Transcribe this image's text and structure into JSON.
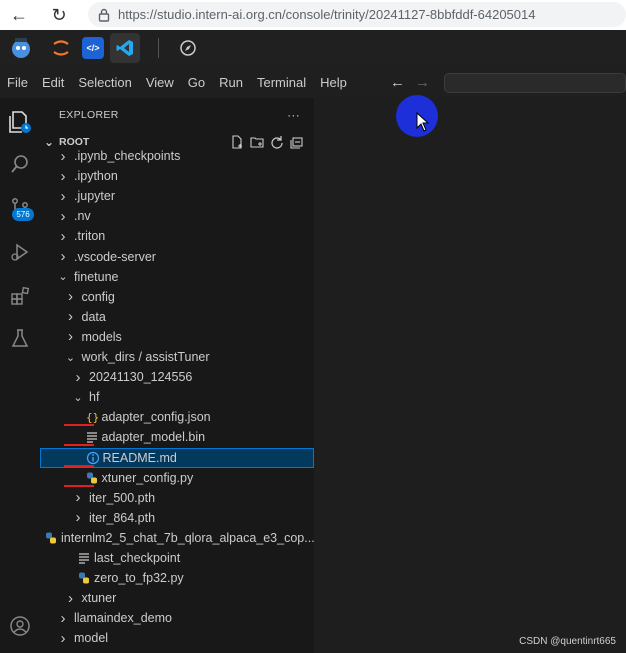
{
  "browser": {
    "url": "https://studio.intern-ai.org.cn/console/trinity/20241127-8bbfddf-64205014"
  },
  "menu": [
    "File",
    "Edit",
    "Selection",
    "View",
    "Go",
    "Run",
    "Terminal",
    "Help"
  ],
  "activity": {
    "scm_badge": "576"
  },
  "explorer": {
    "title": "EXPLORER",
    "more": "···",
    "root": "ROOT",
    "items": [
      {
        "label": ".ipynb_checkpoints",
        "depth": 1,
        "kind": "folder"
      },
      {
        "label": ".ipython",
        "depth": 1,
        "kind": "folder"
      },
      {
        "label": ".jupyter",
        "depth": 1,
        "kind": "folder"
      },
      {
        "label": ".nv",
        "depth": 1,
        "kind": "folder"
      },
      {
        "label": ".triton",
        "depth": 1,
        "kind": "folder"
      },
      {
        "label": ".vscode-server",
        "depth": 1,
        "kind": "folder"
      },
      {
        "label": "finetune",
        "depth": 1,
        "kind": "folder-open"
      },
      {
        "label": "config",
        "depth": 2,
        "kind": "folder"
      },
      {
        "label": "data",
        "depth": 2,
        "kind": "folder"
      },
      {
        "label": "models",
        "depth": 2,
        "kind": "folder"
      },
      {
        "label": "work_dirs / assistTuner",
        "depth": 2,
        "kind": "folder-open"
      },
      {
        "label": "20241130_124556",
        "depth": 3,
        "kind": "folder"
      },
      {
        "label": "hf",
        "depth": 3,
        "kind": "folder-open"
      },
      {
        "label": "adapter_config.json",
        "depth": 4,
        "kind": "json"
      },
      {
        "label": "adapter_model.bin",
        "depth": 4,
        "kind": "bin"
      },
      {
        "label": "README.md",
        "depth": 4,
        "kind": "info"
      },
      {
        "label": "xtuner_config.py",
        "depth": 4,
        "kind": "py"
      },
      {
        "label": "iter_500.pth",
        "depth": 3,
        "kind": "folder"
      },
      {
        "label": "iter_864.pth",
        "depth": 3,
        "kind": "folder"
      },
      {
        "label": "internlm2_5_chat_7b_qlora_alpaca_e3_cop...",
        "depth": 3,
        "kind": "py"
      },
      {
        "label": "last_checkpoint",
        "depth": 3,
        "kind": "bin"
      },
      {
        "label": "zero_to_fp32.py",
        "depth": 3,
        "kind": "py"
      },
      {
        "label": "xtuner",
        "depth": 2,
        "kind": "folder"
      },
      {
        "label": "llamaindex_demo",
        "depth": 1,
        "kind": "folder"
      },
      {
        "label": "model",
        "depth": 1,
        "kind": "folder"
      }
    ],
    "selected_index": 15
  },
  "colors": {
    "accent": "#0078d4",
    "selection": "#04395e",
    "annotation": "#e02020",
    "cursor": "#1d2fd8"
  },
  "watermark": "CSDN @quentinrt665"
}
